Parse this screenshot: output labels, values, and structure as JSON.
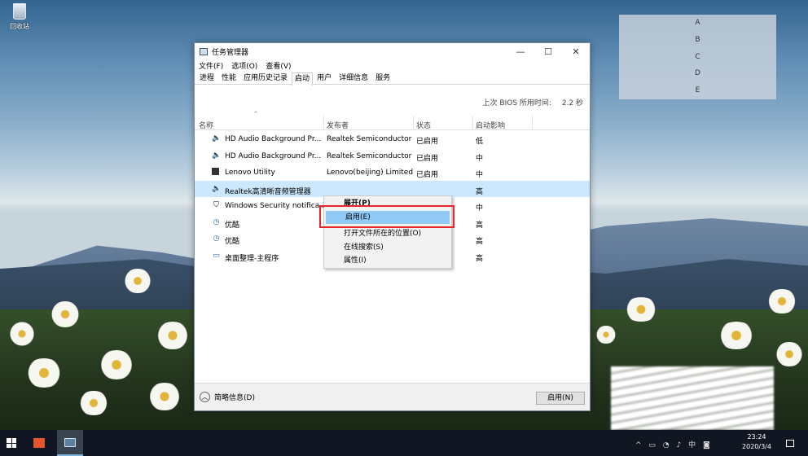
{
  "desktop": {
    "recycle_bin_label": "回收站",
    "side_panel_letters": [
      "A",
      "B",
      "C",
      "D",
      "E"
    ]
  },
  "window": {
    "title": "任务管理器",
    "controls": {
      "minimize": "—",
      "maximize": "☐",
      "close": "✕"
    },
    "menu": [
      "文件(F)",
      "选项(O)",
      "查看(V)"
    ],
    "tabs": [
      "进程",
      "性能",
      "应用历史记录",
      "启动",
      "用户",
      "详细信息",
      "服务"
    ],
    "active_tab": "启动",
    "bios_label": "上次 BIOS 所用时间:",
    "bios_value": "2.2 秒",
    "columns": [
      "名称",
      "发布者",
      "状态",
      "启动影响"
    ],
    "rows": [
      {
        "icon": "speaker-icon",
        "name": "HD Audio Background Pr...",
        "publisher": "Realtek Semiconductor",
        "status": "已启用",
        "impact": "低"
      },
      {
        "icon": "speaker-icon",
        "name": "HD Audio Background Pr...",
        "publisher": "Realtek Semiconductor",
        "status": "已启用",
        "impact": "中"
      },
      {
        "icon": "lenovo-icon",
        "name": "Lenovo Utility",
        "publisher": "Lenovo(beijing) Limited",
        "status": "已启用",
        "impact": "中"
      },
      {
        "icon": "speaker-icon",
        "name": "Realtek高清晰音频管理器",
        "publisher": "",
        "status": "",
        "impact": "高"
      },
      {
        "icon": "shield-icon",
        "name": "Windows Security notifica...",
        "publisher": "",
        "status": "",
        "impact": "中"
      },
      {
        "icon": "clock-icon",
        "name": "优酷",
        "publisher": "",
        "status": "",
        "impact": "高"
      },
      {
        "icon": "clock-icon",
        "name": "优酷",
        "publisher": "",
        "status": "",
        "impact": "高"
      },
      {
        "icon": "monitor-icon",
        "name": "桌面整理-主程序",
        "publisher": "",
        "status": "",
        "impact": "高"
      }
    ],
    "fewer_details": "简略信息(D)",
    "enable_button": "启用(N)"
  },
  "context_menu": {
    "items": [
      "展开(P)",
      "启用(E)",
      "打开文件所在的位置(O)",
      "在线搜索(S)",
      "属性(I)"
    ]
  },
  "taskbar": {
    "time": "23:24",
    "date": "2020/3/4"
  }
}
